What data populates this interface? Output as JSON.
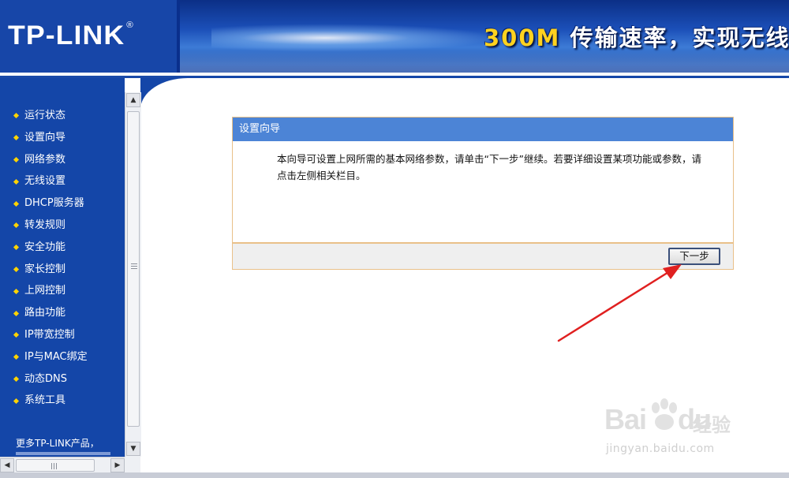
{
  "header": {
    "logo": "TP-LINK",
    "logo_reg": "®",
    "slogan_speed": "300M",
    "slogan_rest": " 传输速率，实现无线自由连接梦想"
  },
  "sidebar": {
    "items": [
      {
        "label": "运行状态"
      },
      {
        "label": "设置向导"
      },
      {
        "label": "网络参数"
      },
      {
        "label": "无线设置"
      },
      {
        "label": "DHCP服务器"
      },
      {
        "label": "转发规则"
      },
      {
        "label": "安全功能"
      },
      {
        "label": "家长控制"
      },
      {
        "label": "上网控制"
      },
      {
        "label": "路由功能"
      },
      {
        "label": "IP带宽控制"
      },
      {
        "label": "IP与MAC绑定"
      },
      {
        "label": "动态DNS"
      },
      {
        "label": "系统工具"
      }
    ],
    "more_products": "更多TP-LINK产品，"
  },
  "wizard": {
    "title": "设置向导",
    "description": "本向导可设置上网所需的基本网络参数，请单击“下一步”继续。若要详细设置某项功能或参数，请点击左侧相关栏目。",
    "next_label": "下一步"
  },
  "watermark": {
    "brand_left": "Bai",
    "brand_right": "du",
    "cn": "经验",
    "url": "jingyan.baidu.com"
  },
  "colors": {
    "sidebar": "#1446a8",
    "header": "#0a2f8c",
    "wizard_header": "#4c84d6",
    "wizard_border": "#e9c089",
    "annotation_arrow": "#e02020"
  }
}
